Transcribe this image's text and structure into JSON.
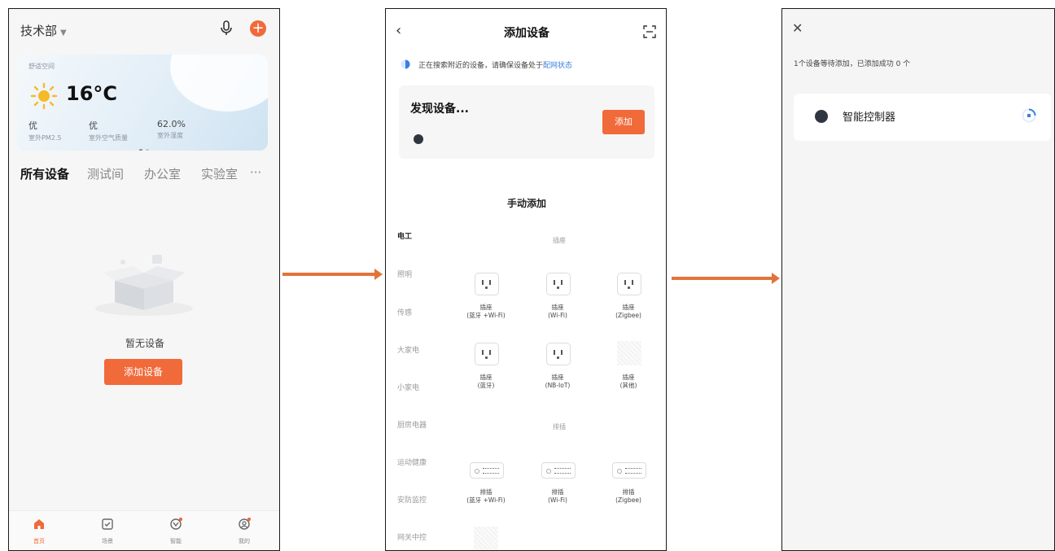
{
  "home": {
    "family": "技术部",
    "weather": {
      "room": "舒适空间",
      "temp": "16°C",
      "stats": [
        {
          "value": "优",
          "label": "室外PM2.5"
        },
        {
          "value": "优",
          "label": "室外空气质量"
        },
        {
          "value": "62.0%",
          "label": "室外湿度"
        }
      ]
    },
    "tabs": [
      "所有设备",
      "测试间",
      "办公室",
      "实验室",
      "···"
    ],
    "empty_text": "暂无设备",
    "add_button": "添加设备",
    "tabbar": [
      {
        "label": "首页",
        "icon": "home-icon"
      },
      {
        "label": "场景",
        "icon": "scene-icon"
      },
      {
        "label": "智能",
        "icon": "smart-icon"
      },
      {
        "label": "我的",
        "icon": "profile-icon"
      }
    ]
  },
  "add_device": {
    "back": "‹",
    "title": "添加设备",
    "search_text": "正在搜索附近的设备，请确保设备处于",
    "search_link": "配网状态",
    "found_title": "发现设备...",
    "found_button": "添加",
    "manual_title": "手动添加",
    "categories": [
      "电工",
      "照明",
      "传感",
      "大家电",
      "小家电",
      "厨房电器",
      "运动健康",
      "安防监控",
      "网关中控"
    ],
    "group_outlet": "插座",
    "group_strip": "排插",
    "outlets": [
      {
        "name": "插座",
        "variant": "(蓝牙 +Wi-Fi)"
      },
      {
        "name": "插座",
        "variant": "(Wi-Fi)"
      },
      {
        "name": "插座",
        "variant": "(Zigbee)"
      },
      {
        "name": "插座",
        "variant": "(蓝牙)"
      },
      {
        "name": "插座",
        "variant": "(NB-IoT)"
      },
      {
        "name": "插座",
        "variant": "(其他)"
      }
    ],
    "strips": [
      {
        "name": "排插",
        "variant": "(蓝牙 +Wi-Fi)"
      },
      {
        "name": "排插",
        "variant": "(Wi-Fi)"
      },
      {
        "name": "排插",
        "variant": "(Zigbee)"
      }
    ]
  },
  "pending": {
    "close": "✕",
    "status": "1个设备等待添加，已添加成功 0 个",
    "device_name": "智能控制器"
  },
  "colors": {
    "accent": "#f06a3a",
    "link": "#3a7fe0",
    "arrow": "#e2743a"
  }
}
